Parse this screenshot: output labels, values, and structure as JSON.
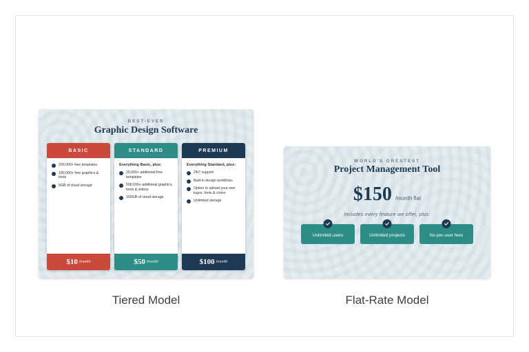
{
  "tiered": {
    "eyebrow": "BEST-EVER",
    "title": "Graphic Design Software",
    "tiers": [
      {
        "name": "BASIC",
        "color": "c-red",
        "lead": "",
        "features": [
          "200,000+ free templates",
          "100,000+ free graphics & fonts",
          "5GB of cloud storage"
        ],
        "price": "$10",
        "unit": "/month"
      },
      {
        "name": "STANDARD",
        "color": "c-teal",
        "lead": "Everything Basic, plus:",
        "features": [
          "20,000+ additional free templates",
          "500,000+ additional graphics, fonts & videos",
          "100GB of cloud storage"
        ],
        "price": "$50",
        "unit": "/month"
      },
      {
        "name": "PREMIUM",
        "color": "c-navy",
        "lead": "Everything Standard, plus:",
        "features": [
          "24/7 support",
          "Built-in design workflows",
          "Option to upload your own logos, fonts & colors",
          "Unlimited storage"
        ],
        "price": "$100",
        "unit": "/month"
      }
    ],
    "caption": "Tiered Model"
  },
  "flat": {
    "eyebrow": "WORLD'S GREATEST",
    "title": "Project Management Tool",
    "price": "$150",
    "unit": "/month flat",
    "tagline": "Includes every feature we offer, plus:",
    "pills": [
      "Unlimited users",
      "Unlimited projects",
      "No per-user fees"
    ],
    "caption": "Flat-Rate Model"
  }
}
